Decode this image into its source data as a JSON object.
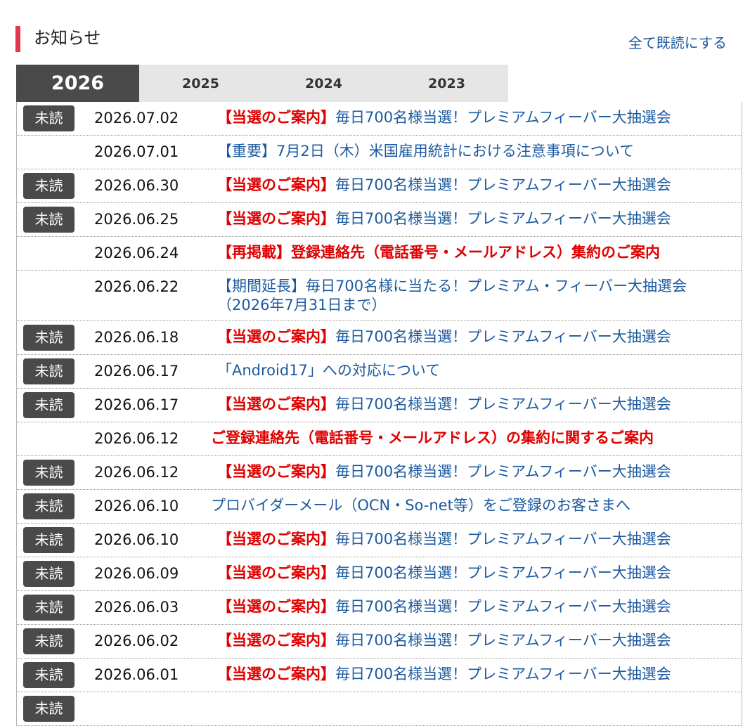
{
  "header": {
    "title": "お知らせ",
    "mark_all_read": "全て既読にする"
  },
  "tabs": [
    {
      "label": "2026",
      "active": true
    },
    {
      "label": "2025",
      "active": false
    },
    {
      "label": "2024",
      "active": false
    },
    {
      "label": "2023",
      "active": false
    }
  ],
  "unread_label": "未読",
  "notices": [
    {
      "unread": true,
      "date": "2026.07.02",
      "prefix": "【当選のご案内】",
      "text": "毎日700名様当選！プレミアムフィーバー大抽選会",
      "style": "link"
    },
    {
      "unread": false,
      "date": "2026.07.01",
      "prefix": "",
      "text": "【重要】7月2日（木）米国雇用統計における注意事項について",
      "style": "link"
    },
    {
      "unread": true,
      "date": "2026.06.30",
      "prefix": "【当選のご案内】",
      "text": "毎日700名様当選！プレミアムフィーバー大抽選会",
      "style": "link"
    },
    {
      "unread": true,
      "date": "2026.06.25",
      "prefix": "【当選のご案内】",
      "text": "毎日700名様当選！プレミアムフィーバー大抽選会",
      "style": "link"
    },
    {
      "unread": false,
      "date": "2026.06.24",
      "prefix": "",
      "text": "【再掲載】登録連絡先（電話番号・メールアドレス）集約のご案内",
      "style": "red"
    },
    {
      "unread": false,
      "date": "2026.06.22",
      "prefix": "",
      "text": "【期間延長】毎日700名様に当たる！プレミアム・フィーバー大抽選会（2026年7月31日まで）",
      "style": "link"
    },
    {
      "unread": true,
      "date": "2026.06.18",
      "prefix": "【当選のご案内】",
      "text": "毎日700名様当選！プレミアムフィーバー大抽選会",
      "style": "link"
    },
    {
      "unread": true,
      "date": "2026.06.17",
      "prefix": "",
      "text": "「Android17」への対応について",
      "style": "link"
    },
    {
      "unread": true,
      "date": "2026.06.17",
      "prefix": "【当選のご案内】",
      "text": "毎日700名様当選！プレミアムフィーバー大抽選会",
      "style": "link"
    },
    {
      "unread": false,
      "date": "2026.06.12",
      "prefix": "",
      "text": "ご登録連絡先（電話番号・メールアドレス）の集約に関するご案内",
      "style": "red",
      "indent": true
    },
    {
      "unread": true,
      "date": "2026.06.12",
      "prefix": "【当選のご案内】",
      "text": "毎日700名様当選！プレミアムフィーバー大抽選会",
      "style": "link"
    },
    {
      "unread": true,
      "date": "2026.06.10",
      "prefix": "",
      "text": "プロバイダーメール（OCN・So-net等）をご登録のお客さまへ",
      "style": "link",
      "indent": true
    },
    {
      "unread": true,
      "date": "2026.06.10",
      "prefix": "【当選のご案内】",
      "text": "毎日700名様当選！プレミアムフィーバー大抽選会",
      "style": "link"
    },
    {
      "unread": true,
      "date": "2026.06.09",
      "prefix": "【当選のご案内】",
      "text": "毎日700名様当選！プレミアムフィーバー大抽選会",
      "style": "link"
    },
    {
      "unread": true,
      "date": "2026.06.03",
      "prefix": "【当選のご案内】",
      "text": "毎日700名様当選！プレミアムフィーバー大抽選会",
      "style": "link"
    },
    {
      "unread": true,
      "date": "2026.06.02",
      "prefix": "【当選のご案内】",
      "text": "毎日700名様当選！プレミアムフィーバー大抽選会",
      "style": "link"
    },
    {
      "unread": true,
      "date": "2026.06.01",
      "prefix": "【当選のご案内】",
      "text": "毎日700名様当選！プレミアムフィーバー大抽選会",
      "style": "link"
    },
    {
      "unread": true,
      "date": "",
      "prefix": "",
      "text": "",
      "style": "link"
    }
  ],
  "colors": {
    "accent_bar": "#e2384c",
    "link": "#1c5aa0",
    "alert_red": "#e00000",
    "badge_bg": "#4a4a4a",
    "tab_active_bg": "#4a4a4a",
    "tab_inactive_bg": "#e6e6e6"
  }
}
